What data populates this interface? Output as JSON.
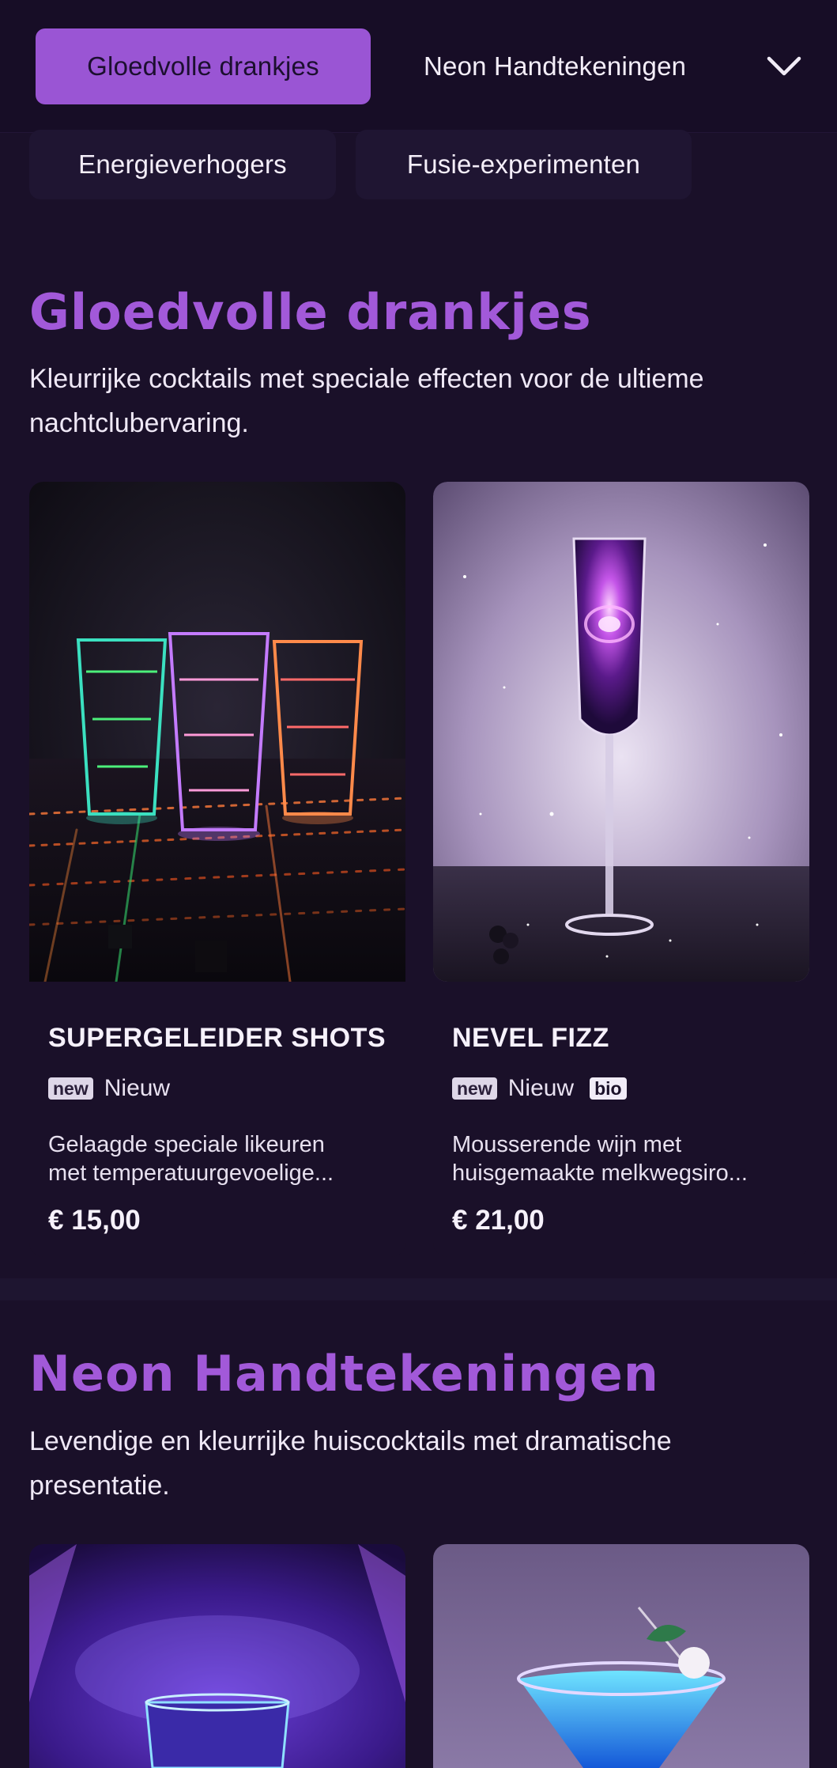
{
  "nav": {
    "categories": [
      {
        "label": "Gloedvolle drankjes",
        "active": true
      },
      {
        "label": "Neon Handtekeningen",
        "active": false
      },
      {
        "label": "Energieverhogers",
        "active": false
      },
      {
        "label": "Fusie-experimenten",
        "active": false
      }
    ],
    "expand_icon": "chevron-down-icon"
  },
  "sections": [
    {
      "title": "Gloedvolle drankjes",
      "description": "Kleurrijke cocktails met speciale effecten voor de ultieme nachtclubervaring.",
      "items": [
        {
          "name": "SUPERGELEIDER SHOTS",
          "badge_new": "new",
          "badge_label": "Nieuw",
          "badge_bio": "",
          "description_line1": "Gelaagde speciale likeuren",
          "description_line2": "met temperatuurgevoelige...",
          "price": "€ 15,00"
        },
        {
          "name": "NEVEL FIZZ",
          "badge_new": "new",
          "badge_label": "Nieuw",
          "badge_bio": "bio",
          "description_line1": "Mousserende wijn met",
          "description_line2": "huisgemaakte melkwegsiro...",
          "price": "€ 21,00"
        }
      ]
    },
    {
      "title": "Neon Handtekeningen",
      "description": "Levendige en kleurrijke huiscocktails met dramatische presentatie.",
      "items": []
    }
  ],
  "colors": {
    "background": "#1a1029",
    "accent": "#a259d9",
    "active_chip": "#9a55d4"
  }
}
